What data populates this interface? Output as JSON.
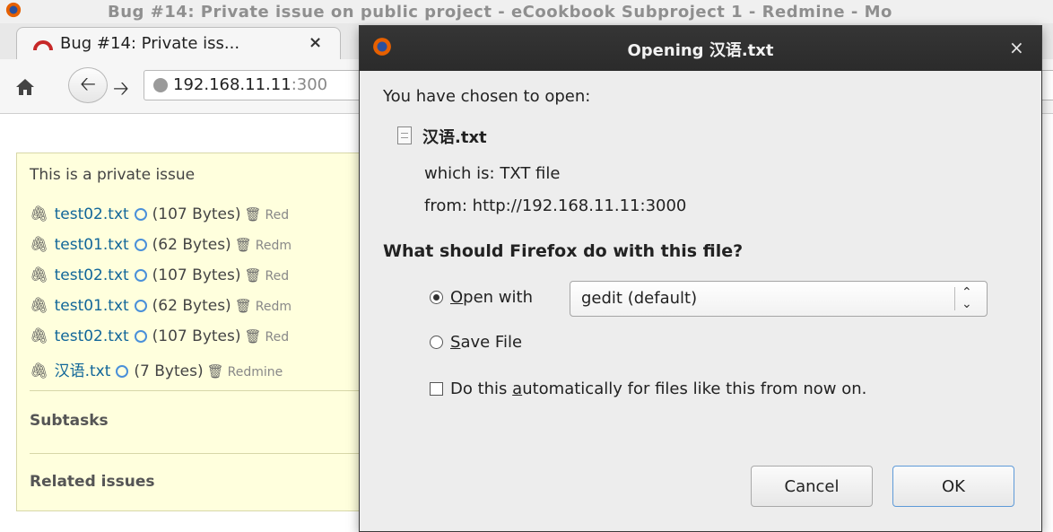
{
  "window": {
    "title": "Bug #14: Private issue on public project - eCookbook Subproject 1 - Redmine - Mo"
  },
  "tab": {
    "label": "Bug #14: Private iss...",
    "close": "×"
  },
  "navbar": {
    "url_main": "192.168.11.11",
    "url_rest": ":300"
  },
  "issue": {
    "description": "This is a private issue",
    "attachments": [
      {
        "name": "test02.txt",
        "size": "(107 Bytes)",
        "author": "Red"
      },
      {
        "name": "test01.txt",
        "size": "(62 Bytes)",
        "author": "Redm"
      },
      {
        "name": "test02.txt",
        "size": "(107 Bytes)",
        "author": "Red"
      },
      {
        "name": "test01.txt",
        "size": "(62 Bytes)",
        "author": "Redm"
      },
      {
        "name": "test02.txt",
        "size": "(107 Bytes)",
        "author": "Red"
      },
      {
        "name": "汉语.txt",
        "size": "(7 Bytes)",
        "author": "Redmine"
      }
    ],
    "subtasks_title": "Subtasks",
    "related_title": "Related issues"
  },
  "dialog": {
    "title": "Opening 汉语.txt",
    "close": "×",
    "chosen_label": "You have chosen to open:",
    "file_name": "汉语.txt",
    "which_is": "which is: TXT file",
    "from": "from: http://192.168.11.11:3000",
    "question": "What should Firefox do with this file?",
    "open_with_first": "O",
    "open_with_rest": "pen with",
    "open_with_app": "gedit (default)",
    "save_file_first": "S",
    "save_file_rest": "ave File",
    "auto_prefix": "Do this ",
    "auto_key": "a",
    "auto_rest": "utomatically for files like this from now on.",
    "cancel_label": "Cancel",
    "ok_label": "OK",
    "selected_action": "open_with"
  }
}
